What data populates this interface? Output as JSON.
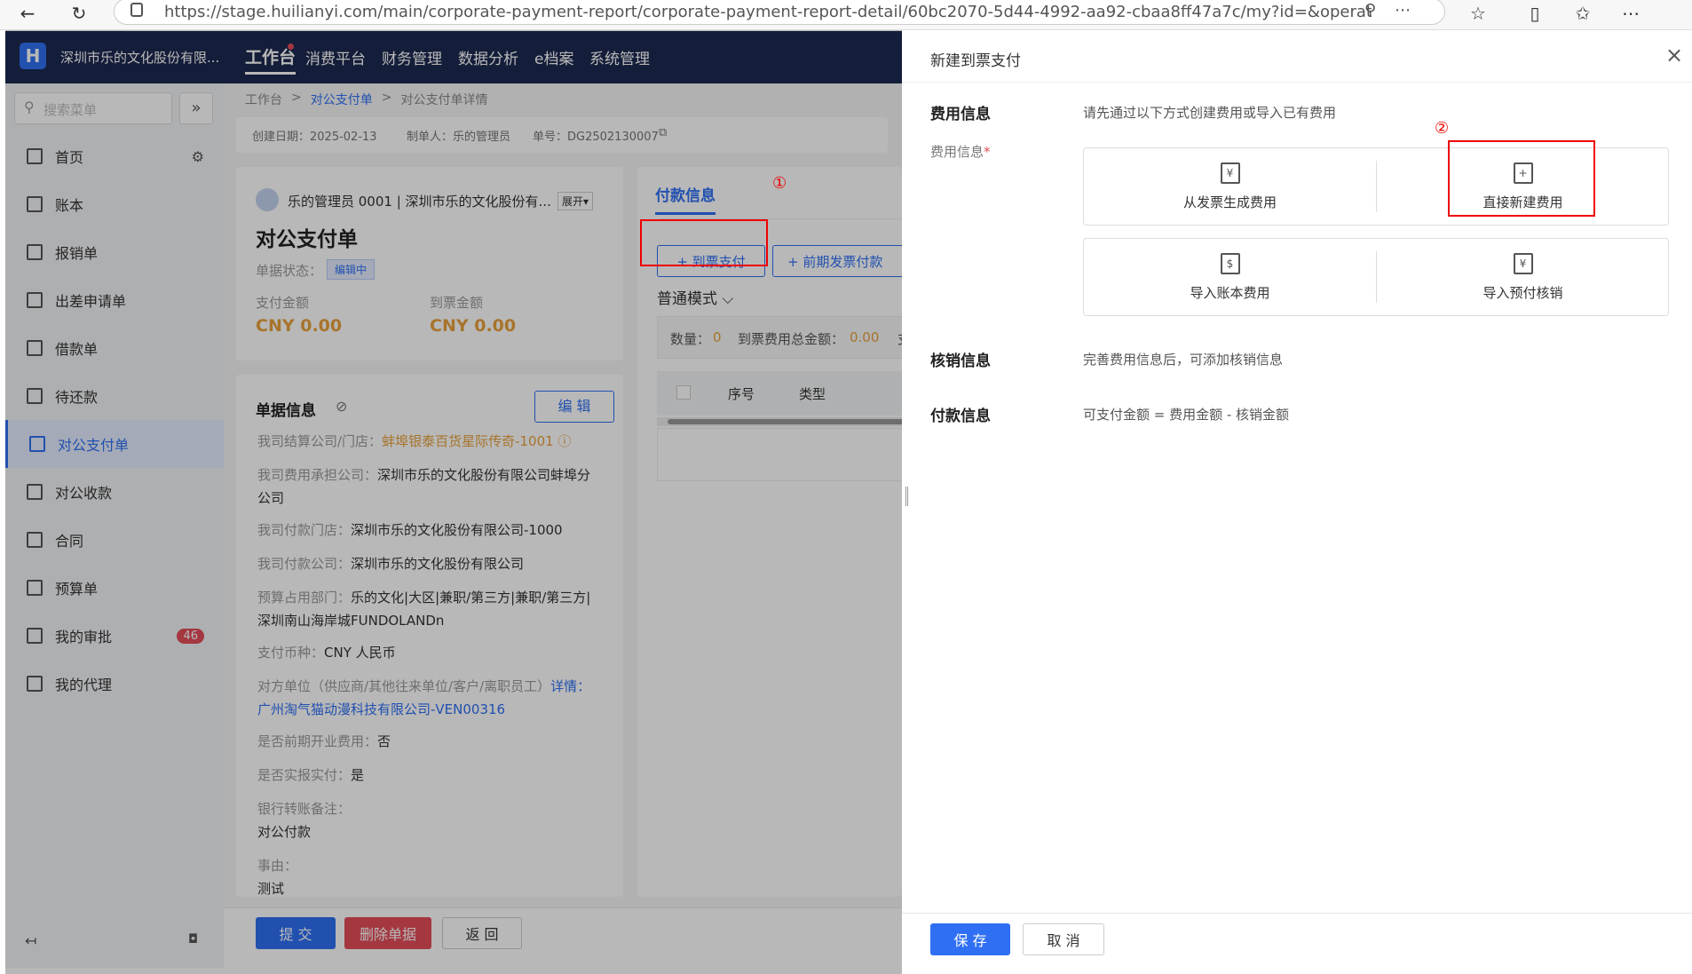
{
  "browser": {
    "url": "https://stage.huilianyi.com/main/corporate-payment-report/corporate-payment-report-detail/60bc2070-5d44-4992-aa92-cbaa8ff47a7c/my?id=&operate=isNew&payment…"
  },
  "topnav": {
    "logo": "H",
    "company": "深圳市乐的文化股份有限...",
    "tabs": [
      "工作台",
      "消费平台",
      "财务管理",
      "数据分析",
      "e档案",
      "系统管理"
    ]
  },
  "sidebar": {
    "search_placeholder": "搜索菜单",
    "collapse": "»",
    "items": [
      {
        "label": "首页"
      },
      {
        "label": "账本"
      },
      {
        "label": "报销单"
      },
      {
        "label": "出差申请单"
      },
      {
        "label": "借款单"
      },
      {
        "label": "待还款"
      },
      {
        "label": "对公支付单"
      },
      {
        "label": "对公收款"
      },
      {
        "label": "合同"
      },
      {
        "label": "预算单"
      },
      {
        "label": "我的审批",
        "badge": "46"
      },
      {
        "label": "我的代理"
      }
    ]
  },
  "breadcrumb": {
    "items": [
      "工作台",
      "对公支付单",
      "对公支付单详情"
    ],
    "sep": ">"
  },
  "meta": {
    "created": "创建日期：2025-02-13",
    "creator": "制单人：乐的管理员",
    "number": "单号：DG2502130007"
  },
  "header": {
    "user": "乐的管理员 0001 | 深圳市乐的文化股份有...",
    "expand": "展开▾",
    "title": "对公支付单",
    "status_label": "单据状态：",
    "status": "编辑中",
    "pay_amount_label": "支付金额",
    "pay_amount": "CNY 0.00",
    "invoice_amount_label": "到票金额",
    "invoice_amount": "CNY 0.00"
  },
  "docinfo": {
    "title": "单据信息",
    "edit": "编 辑",
    "rows": [
      {
        "k": "我司结算公司/门店：",
        "v": "蚌埠银泰百货星际传奇-1001 ⓘ"
      },
      {
        "k": "我司费用承担公司：",
        "v": "深圳市乐的文化股份有限公司蚌埠分公司"
      },
      {
        "k": "我司付款门店：",
        "v": "深圳市乐的文化股份有限公司-1000"
      },
      {
        "k": "我司付款公司：",
        "v": "深圳市乐的文化股份有限公司"
      },
      {
        "k": "预算占用部门：",
        "v": "乐的文化|大区|兼职/第三方|兼职/第三方|深圳南山海岸城FUNDOLANDn"
      },
      {
        "k": "支付币种：",
        "v": "CNY 人民币"
      },
      {
        "k": "对方单位（供应商/其他往来单位/客户/离职员工）",
        "v": "详情：广州淘气猫动漫科技有限公司-VEN00316"
      },
      {
        "k": "是否前期开业费用：",
        "v": "否"
      },
      {
        "k": "是否实报实付：",
        "v": "是"
      },
      {
        "k": "银行转账备注：",
        "v": "对公付款"
      },
      {
        "k": "事由：",
        "v": "测试"
      }
    ]
  },
  "payinfo": {
    "tab": "付款信息",
    "btn_invoice": "+ 到票支付",
    "btn_prev": "+ 前期发票付款",
    "mode": "普通模式 ⌵",
    "summary_count_label": "数量：",
    "summary_count": "0",
    "summary_total_label": "到票费用总金额：",
    "summary_total": "0.00",
    "summary_more": "支",
    "col_index": "序号",
    "col_type": "类型"
  },
  "footer": {
    "submit": "提 交",
    "delete": "删除单据",
    "back": "返 回"
  },
  "drawer": {
    "title": "新建到票支付",
    "close": "×",
    "fee_section": "费用信息",
    "fee_hint": "请先通过以下方式创建费用或导入已有费用",
    "fee_label": "费用信息",
    "required": "*",
    "options": [
      {
        "label": "从发票生成费用",
        "icon": "¥"
      },
      {
        "label": "直接新建费用",
        "icon": "+"
      },
      {
        "label": "导入账本费用",
        "icon": "$"
      },
      {
        "label": "导入预付核销",
        "icon": "¥"
      }
    ],
    "writeoff_section": "核销信息",
    "writeoff_hint": "完善费用信息后，可添加核销信息",
    "payment_section": "付款信息",
    "payment_hint": "可支付金额 = 费用金额 - 核销金额",
    "save": "保 存",
    "cancel": "取 消"
  },
  "annotations": {
    "mark1": "①",
    "mark2": "②"
  }
}
